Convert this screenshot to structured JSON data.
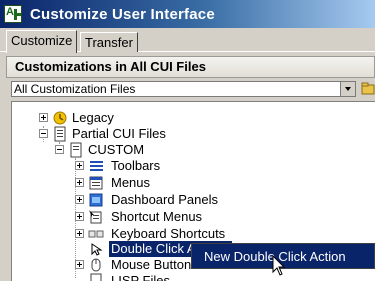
{
  "window": {
    "title": "Customize User Interface"
  },
  "tabs": [
    {
      "label": "Customize",
      "active": true
    },
    {
      "label": "Transfer",
      "active": false
    }
  ],
  "section": {
    "title": "Customizations in All CUI Files"
  },
  "filter": {
    "selected": "All Customization Files"
  },
  "tree": {
    "legacy": "Legacy",
    "partial": "Partial CUI Files",
    "custom": "CUSTOM",
    "toolbars": "Toolbars",
    "menus": "Menus",
    "dashboard": "Dashboard Panels",
    "shortcut_menus": "Shortcut Menus",
    "keyboard": "Keyboard Shortcuts",
    "double_click": "Double Click Actions",
    "mouse_buttons": "Mouse Buttons",
    "lisp_files": "LISP Files"
  },
  "context_menu": {
    "item": "New Double Click Action"
  },
  "colors": {
    "selection": "#0a246a",
    "titlebar_start": "#0a246a",
    "titlebar_end": "#a6caf0"
  },
  "icons": [
    "app-icon",
    "legacy-icon",
    "partial-cui-icon",
    "custom-cui-icon",
    "toolbars-icon",
    "menus-icon",
    "dashboard-icon",
    "shortcut-menus-icon",
    "keyboard-icon",
    "double-click-icon",
    "mouse-icon",
    "lisp-icon",
    "cursor-icon"
  ]
}
